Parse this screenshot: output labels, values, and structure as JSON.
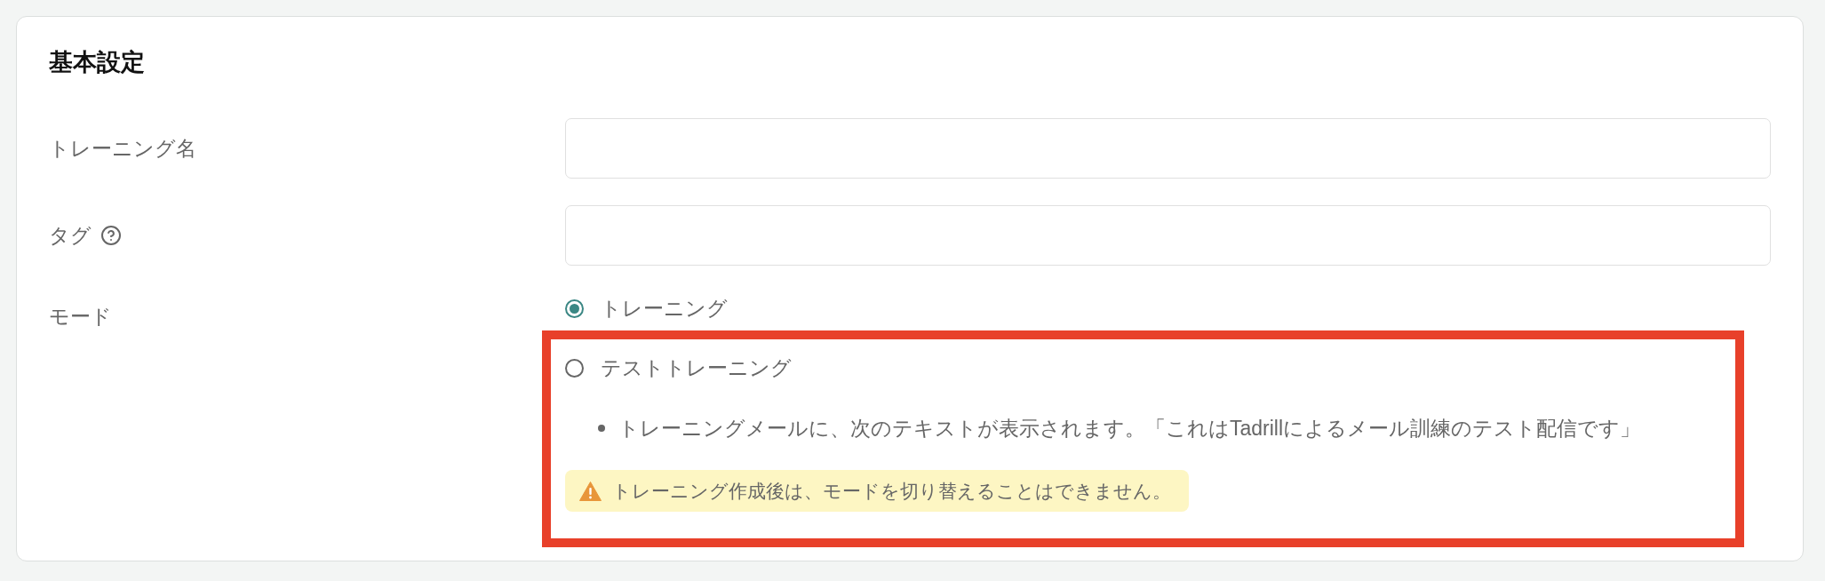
{
  "section": {
    "title": "基本設定"
  },
  "fields": [
    {
      "kind": "text",
      "label": "トレーニング名"
    },
    {
      "kind": "text",
      "label": "タグ",
      "help_icon": true
    },
    {
      "kind": "radio",
      "label": "モード",
      "options": [
        {
          "label": "トレーニング",
          "selected": true,
          "highlighted": false
        },
        {
          "label": "テストトレーニング",
          "selected": false,
          "highlighted": true,
          "notes": [
            "トレーニングメールに、次のテキストが表示されます。「これはTadrillによるメール訓練のテスト配信です」"
          ],
          "warning": "トレーニング作成後は、モードを切り替えることはできません。"
        }
      ]
    }
  ]
}
